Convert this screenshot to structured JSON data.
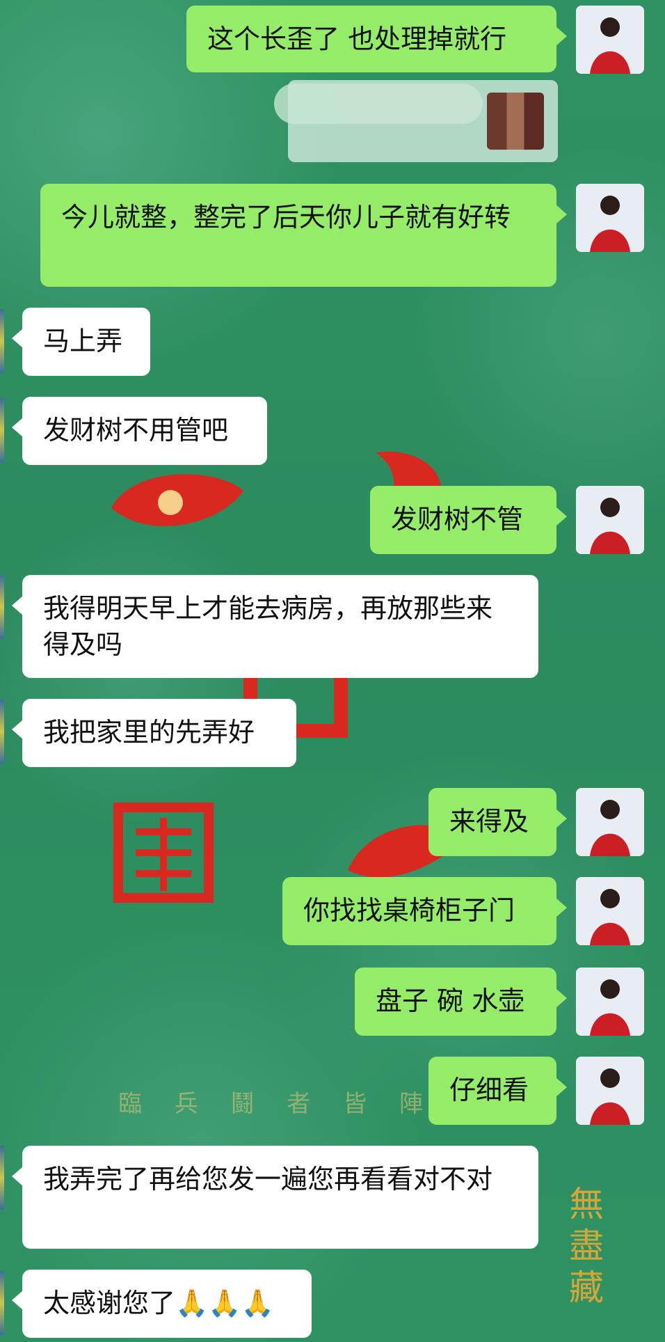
{
  "chat": {
    "messages": [
      {
        "side": "out",
        "text": "这个长歪了 也处理掉就行"
      },
      {
        "side": "out",
        "type": "image"
      },
      {
        "side": "out",
        "text": "今儿就整，整完了后天你儿子就有好转"
      },
      {
        "side": "in",
        "text": "马上弄"
      },
      {
        "side": "in",
        "text": "发财树不用管吧"
      },
      {
        "side": "out",
        "text": "发财树不管"
      },
      {
        "side": "in",
        "text": "我得明天早上才能去病房，再放那些来得及吗"
      },
      {
        "side": "in",
        "text": "我把家里的先弄好"
      },
      {
        "side": "out",
        "text": "来得及"
      },
      {
        "side": "out",
        "text": "你找找桌椅柜子门"
      },
      {
        "side": "out",
        "text": "盘子 碗 水壶"
      },
      {
        "side": "out",
        "text": "仔细看"
      },
      {
        "side": "in",
        "text": "我弄完了再给您发一遍您再看看对不对"
      },
      {
        "side": "in",
        "text": "太感谢您了🙏🙏🙏"
      }
    ]
  },
  "background": {
    "seal_text": "臨 兵 鬪 者 皆 陣 列 前",
    "corner_mark": "無盡藏"
  },
  "colors": {
    "outgoing_bubble": "#95ec69",
    "incoming_bubble": "#ffffff",
    "background_green": "#2e8f5e",
    "accent_red": "#d8281f",
    "gold": "#d3a53b"
  }
}
